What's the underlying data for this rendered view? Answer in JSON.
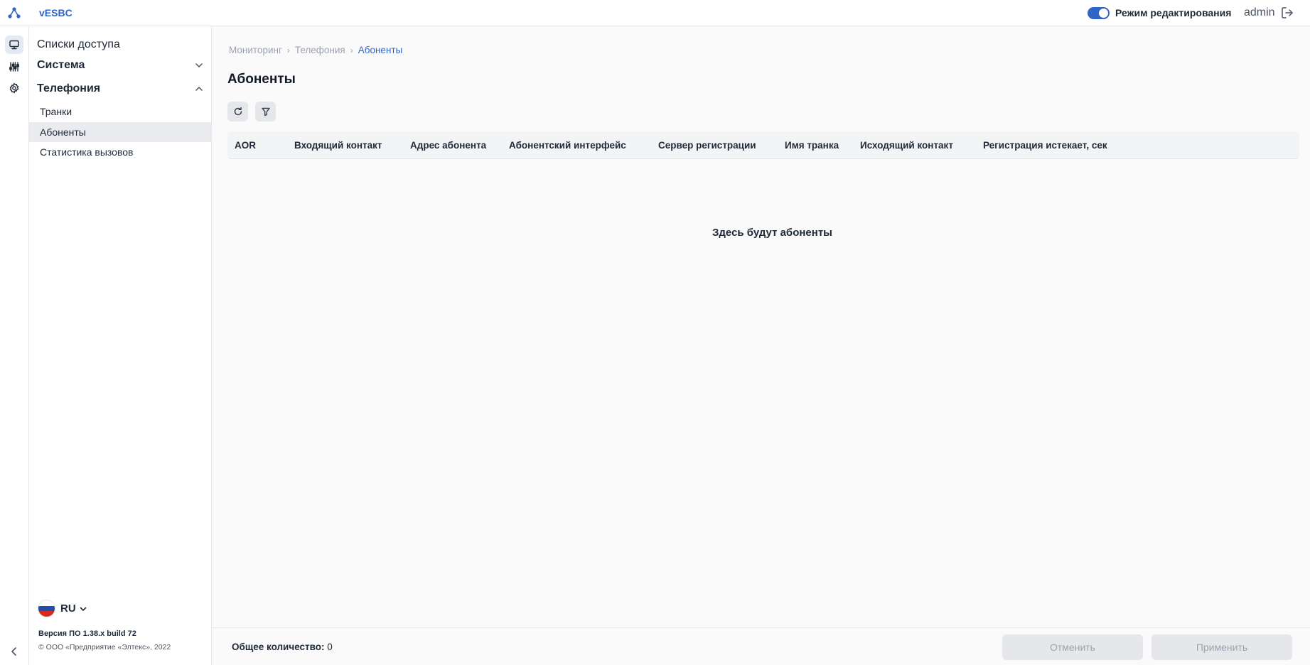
{
  "header": {
    "app_title": "vESBC",
    "edit_mode_label": "Режим редактирования",
    "edit_mode_enabled": true,
    "user": "admin"
  },
  "rail": {
    "items": [
      {
        "icon": "monitor-icon",
        "active": true
      },
      {
        "icon": "equalizer-icon",
        "active": false
      },
      {
        "icon": "gear-icon",
        "active": false
      }
    ],
    "collapse_icon": "chevron-left-icon"
  },
  "sidebar": {
    "access_lists": "Списки доступа",
    "groups": [
      {
        "label": "Система",
        "expanded": false
      },
      {
        "label": "Телефония",
        "expanded": true
      }
    ],
    "telephony_items": [
      "Транки",
      "Абоненты",
      "Статистика вызовов"
    ],
    "active_item": "Абоненты",
    "language": "RU",
    "version": "Версия ПО 1.38.x build 72",
    "copyright": "© ООО «Предприятие «Элтекс», 2022"
  },
  "main": {
    "breadcrumb": [
      "Мониторинг",
      "Телефония",
      "Абоненты"
    ],
    "title": "Абоненты",
    "toolbar": {
      "refresh_icon": "refresh-icon",
      "filter_icon": "filter-icon"
    },
    "columns": [
      "AOR",
      "Входящий контакт",
      "Адрес абонента",
      "Абонентский интерфейс",
      "Сервер регистрации",
      "Имя транка",
      "Исходящий контакт",
      "Регистрация истекает, сек"
    ],
    "empty_message": "Здесь будут абоненты",
    "total_label": "Общее количество:",
    "total_value": "0",
    "cancel_label": "Отменить",
    "apply_label": "Применить"
  },
  "colors": {
    "accent": "#2f65c8",
    "flag_white": "#ffffff",
    "flag_blue": "#1f4fa8",
    "flag_red": "#d52b1e"
  }
}
